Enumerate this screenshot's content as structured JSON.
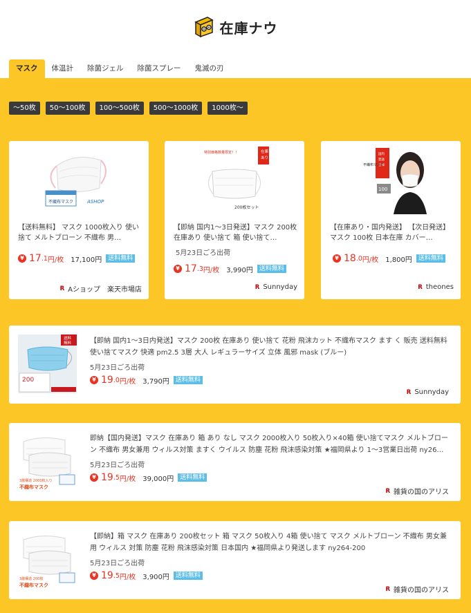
{
  "brand": {
    "name": "在庫ナウ"
  },
  "tabs": [
    {
      "label": "マスク"
    },
    {
      "label": "体温計"
    },
    {
      "label": "除菌ジェル"
    },
    {
      "label": "除菌スプレー"
    },
    {
      "label": "鬼滅の刃"
    }
  ],
  "filters": [
    {
      "label": "〜50枚"
    },
    {
      "label": "50〜100枚"
    },
    {
      "label": "100〜500枚"
    },
    {
      "label": "500〜1000枚"
    },
    {
      "label": "1000枚〜"
    }
  ],
  "grid_items": [
    {
      "title": "【送料無料】 マスク 1000枚入り 使い捨て メルトブローン 不織布 男…",
      "ship": "",
      "price_int": "17",
      "price_dec": ".1",
      "price_unit": "円/枚",
      "total": "17,100円",
      "badge": "送料無料",
      "shop": "Aショップ　楽天市場店",
      "img_label": "不織布マスク"
    },
    {
      "title": "【即納 国内1〜3日発送】マスク 200枚 在庫あり 使い捨て 箱 使い捨て…",
      "ship": "5月23日ごろ出荷",
      "price_int": "17",
      "price_dec": ".3",
      "price_unit": "円/枚",
      "total": "3,990円",
      "badge": "送料無料",
      "shop": "Sunnyday",
      "img_label": "200枚セット"
    },
    {
      "title": "【在庫あり・国内発送】 【次日発送】マスク 100枚 日本在庫 カバー…",
      "ship": "",
      "price_int": "18",
      "price_dec": ".0",
      "price_unit": "円/枚",
      "total": "1,800円",
      "badge": "送料無料",
      "shop": "theones",
      "img_label": "不織布マスク"
    }
  ],
  "list_items": [
    {
      "title": "【即納 国内1〜3日内発送】マスク 200枚 在庫あり 使い捨て 花粉 飛沫カット 不織布マスク ます く 販売 送料無料 使い捨てマスク 快適 pm2.5 3層 大人 レギュラーサイズ 立体 風邪 mask (ブルー)",
      "ship": "5月23日ごろ出荷",
      "price_int": "19",
      "price_dec": ".0",
      "price_unit": "円/枚",
      "total": "3,790円",
      "badge": "送料無料",
      "shop": "Sunnyday",
      "img_label": "200"
    },
    {
      "title": "即納【国内発送】マスク 在庫あり 箱 あり なし マスク 2000枚入り 50枚入り×40箱 使い捨てマスク メルトブローン 不織布 男女兼用 ウィルス対策 ますく ウイルス 防塵 花粉 飛沫感染対策 ★福岡県より 1〜3営業日出荷 ny26…",
      "ship": "5月23日ごろ出荷",
      "price_int": "19",
      "price_dec": ".5",
      "price_unit": "円/枚",
      "total": "39,000円",
      "badge": "送料無料",
      "shop": "雑貨の国のアリス",
      "img_label": "不織布マスク"
    },
    {
      "title": "【即納】箱 マスク 在庫あり 200枚セット 箱 マスク 50枚入り 4箱 使い捨て マスク メルトブローン 不織布 男女兼用 ウィルス 対策 防塵 花粉 飛沫感染対策 日本国内 ★福岡県より発送します ny264-200",
      "ship": "5月23日ごろ出荷",
      "price_int": "19",
      "price_dec": ".5",
      "price_unit": "円/枚",
      "total": "3,900円",
      "badge": "送料無料",
      "shop": "雑貨の国のアリス",
      "img_label": "不織布マスク"
    }
  ],
  "icons": {
    "rakuten": "R",
    "yen": "¥"
  },
  "colors": {
    "brand_yellow": "#fcc627",
    "price_red": "#e83424",
    "badge_blue": "#5bbde8"
  }
}
